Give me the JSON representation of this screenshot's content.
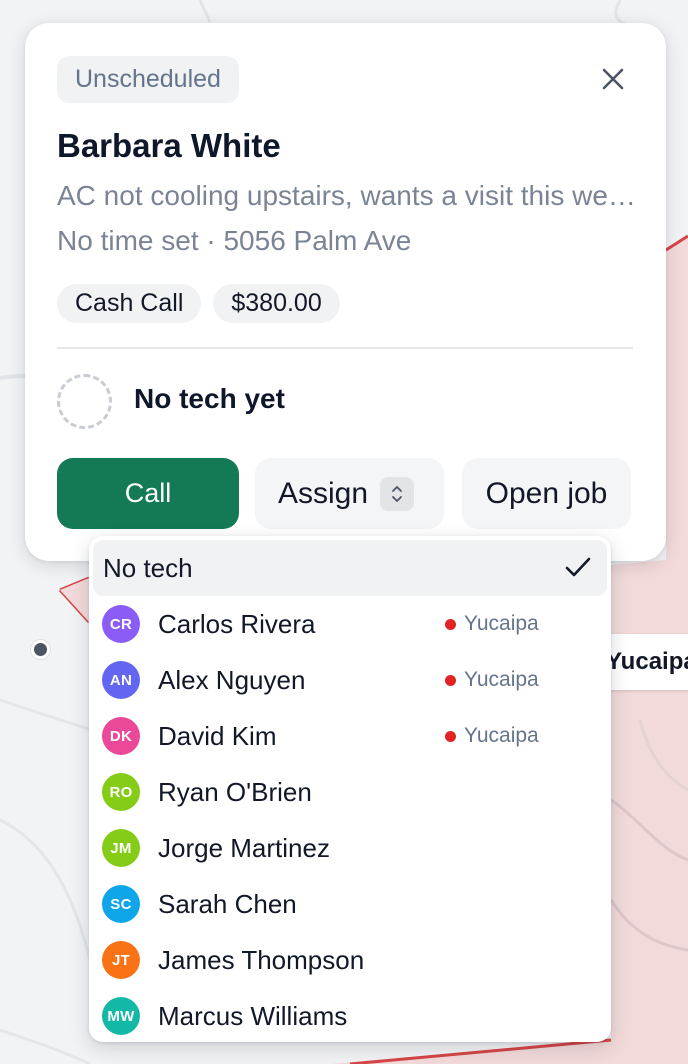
{
  "colors": {
    "primary_green": "#137a55",
    "location_dot": "#e02424",
    "zone_border": "#d64545",
    "zone_fill": "#f3dada"
  },
  "map": {
    "region_label": "Yucaipa"
  },
  "card": {
    "status_badge": "Unscheduled",
    "close_icon": "close-icon",
    "customer_name": "Barbara White",
    "description": "AC not cooling upstairs, wants a visit this week before the heat wave",
    "meta": "No time set · 5056 Palm Ave",
    "chips": [
      "Cash Call",
      "$380.00"
    ],
    "tech_status": "No tech yet",
    "buttons": {
      "call": "Call",
      "assign": "Assign",
      "open_job": "Open job"
    }
  },
  "dropdown": {
    "selected_option": "No tech",
    "techs": [
      {
        "initials": "CR",
        "name": "Carlos Rivera",
        "color": "#8b5cf6",
        "location": "Yucaipa"
      },
      {
        "initials": "AN",
        "name": "Alex Nguyen",
        "color": "#6366f1",
        "location": "Yucaipa"
      },
      {
        "initials": "DK",
        "name": "David Kim",
        "color": "#ec4899",
        "location": "Yucaipa"
      },
      {
        "initials": "RO",
        "name": "Ryan O'Brien",
        "color": "#84cc16",
        "location": ""
      },
      {
        "initials": "JM",
        "name": "Jorge Martinez",
        "color": "#84cc16",
        "location": ""
      },
      {
        "initials": "SC",
        "name": "Sarah Chen",
        "color": "#0ea5e9",
        "location": ""
      },
      {
        "initials": "JT",
        "name": "James Thompson",
        "color": "#f97316",
        "location": ""
      },
      {
        "initials": "MW",
        "name": "Marcus Williams",
        "color": "#14b8a6",
        "location": ""
      }
    ]
  }
}
